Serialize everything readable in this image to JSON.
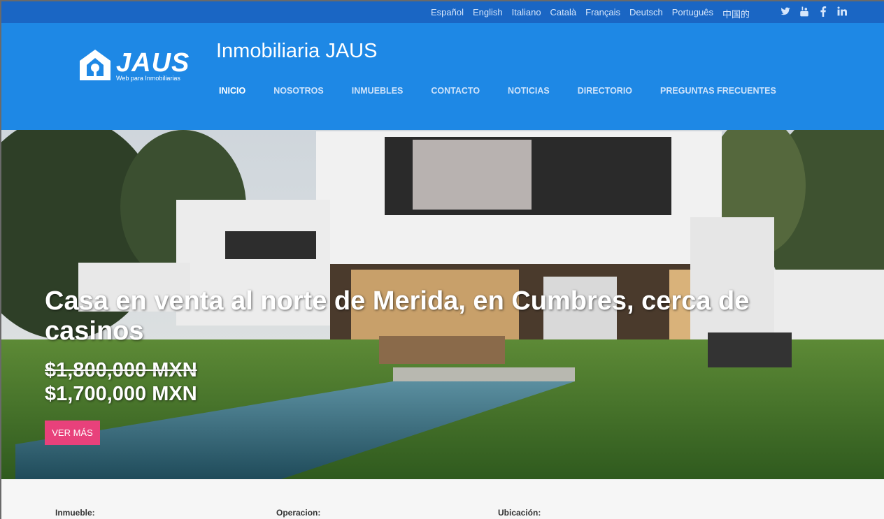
{
  "topbar": {
    "languages": [
      "Español",
      "English",
      "Italiano",
      "Català",
      "Français",
      "Deutsch",
      "Português",
      "中国的"
    ],
    "social": [
      "twitter-icon",
      "youtube-icon",
      "facebook-icon",
      "linkedin-icon"
    ],
    "social_glyphs": [
      "🐦",
      "▶",
      "f",
      "in"
    ]
  },
  "header": {
    "logo_text": "JAUS",
    "logo_tagline": "Web para Inmobiliarias",
    "site_title": "Inmobiliaria JAUS",
    "nav": [
      "INICIO",
      "NOSOTROS",
      "INMUEBLES",
      "CONTACTO",
      "NOTICIAS",
      "DIRECTORIO",
      "PREGUNTAS FRECUENTES"
    ],
    "active_nav": "INICIO"
  },
  "hero": {
    "title": "Casa en venta al norte de Merida, en Cumbres, cerca de casinos",
    "old_price": "$1,800,000 MXN",
    "new_price": "$1,700,000 MXN",
    "button": "VER MÁS"
  },
  "search": {
    "inmueble_label": "Inmueble:",
    "operacion_label": "Operacion:",
    "ubicacion_label": "Ubicación:"
  },
  "colors": {
    "topbar": "#1a66c4",
    "header": "#1e88e5",
    "button": "#e8417b"
  }
}
